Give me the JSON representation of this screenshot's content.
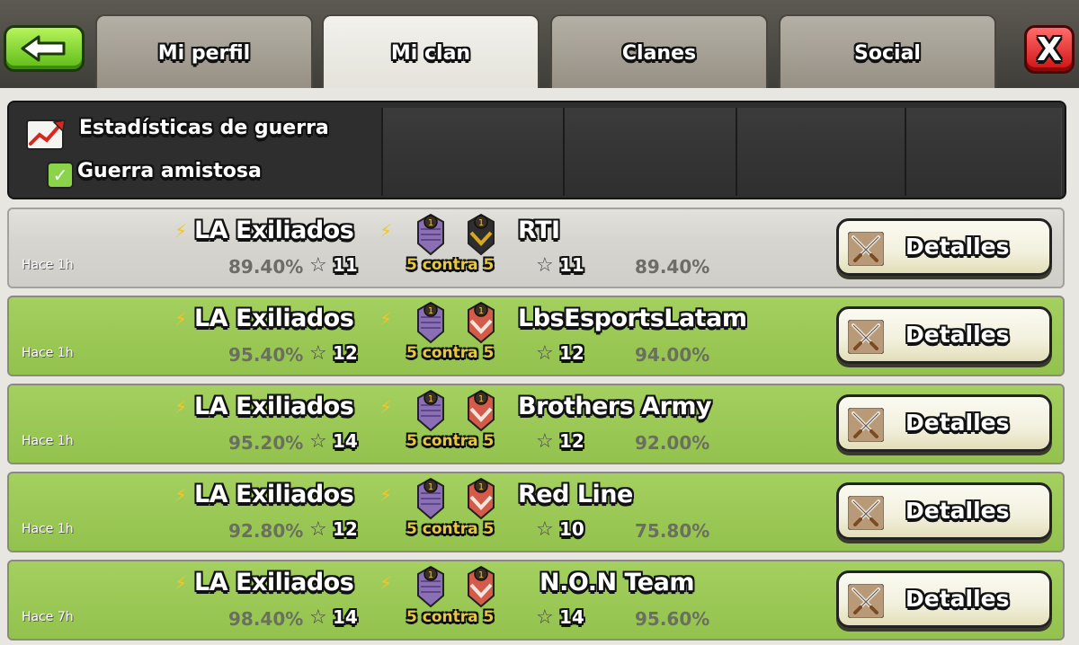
{
  "header": {
    "tabs": [
      {
        "label": "Mi perfil",
        "active": false
      },
      {
        "label": "Mi clan",
        "active": true
      },
      {
        "label": "Clanes",
        "active": false
      },
      {
        "label": "Social",
        "active": false
      }
    ],
    "back_icon": "back-arrow-icon",
    "close_label": "X"
  },
  "stats_header": {
    "title": "Estadísticas de guerra",
    "friendly_label": "Guerra amistosa",
    "friendly_checked": true,
    "check_glyph": "✓",
    "icon": "chart-icon"
  },
  "wars": [
    {
      "time": "Hace 1h",
      "clan": "LA Exiliados",
      "clan_pct": "89.40%",
      "clan_stars": "11",
      "vs": "5 contra 5",
      "opponent": "RTI",
      "opp_stars": "11",
      "opp_pct": "89.40%",
      "details": "Detalles",
      "result": "draw"
    },
    {
      "time": "Hace 1h",
      "clan": "LA Exiliados",
      "clan_pct": "95.40%",
      "clan_stars": "12",
      "vs": "5 contra 5",
      "opponent": "LbsEsportsLatam",
      "opp_stars": "12",
      "opp_pct": "94.00%",
      "details": "Detalles",
      "result": "win"
    },
    {
      "time": "Hace 1h",
      "clan": "LA Exiliados",
      "clan_pct": "95.20%",
      "clan_stars": "14",
      "vs": "5 contra 5",
      "opponent": "Brothers Army",
      "opp_stars": "12",
      "opp_pct": "92.00%",
      "details": "Detalles",
      "result": "win"
    },
    {
      "time": "Hace 1h",
      "clan": "LA Exiliados",
      "clan_pct": "92.80%",
      "clan_stars": "12",
      "vs": "5 contra 5",
      "opponent": "Red Line",
      "opp_stars": "10",
      "opp_pct": "75.80%",
      "details": "Detalles",
      "result": "win"
    },
    {
      "time": "Hace 7h",
      "clan": "LA Exiliados",
      "clan_pct": "98.40%",
      "clan_stars": "14",
      "vs": "5 contra 5",
      "opponent": "N.O.N  Team",
      "opp_stars": "14",
      "opp_pct": "95.60%",
      "details": "Detalles",
      "result": "win"
    }
  ],
  "colors": {
    "win_row": "#9fcc5a",
    "draw_row": "#d6d5cf",
    "vs_text": "#e8c93a",
    "bolt": "#f2c52b"
  }
}
